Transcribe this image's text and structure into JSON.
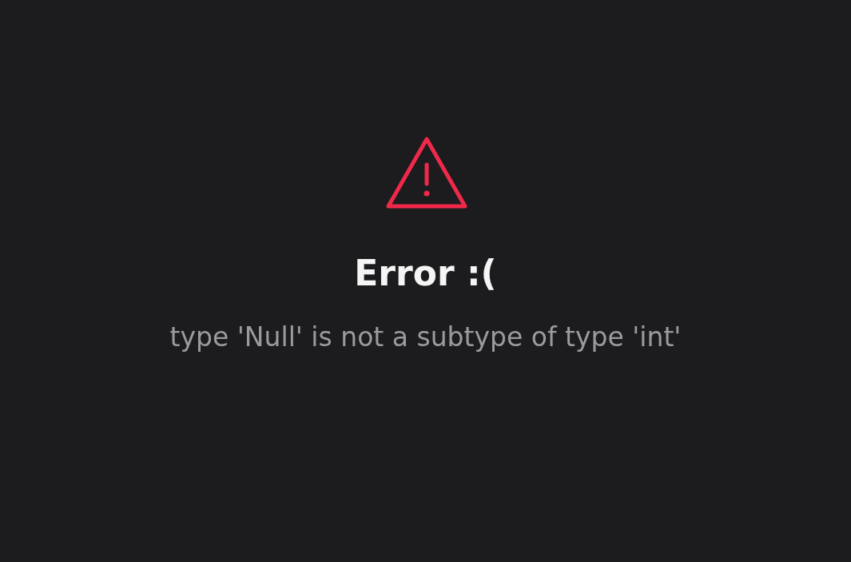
{
  "error": {
    "title": "Error :(",
    "message": "type 'Null' is not a subtype of type 'int'"
  }
}
